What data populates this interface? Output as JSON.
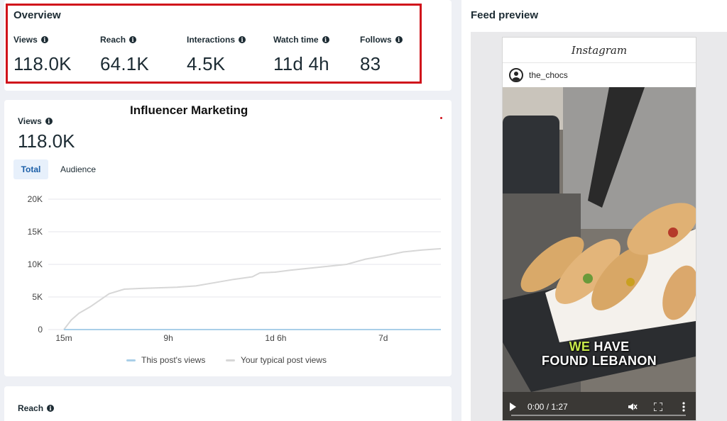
{
  "overview": {
    "title": "Overview",
    "metrics": [
      {
        "label": "Views",
        "value": "118.0K"
      },
      {
        "label": "Reach",
        "value": "64.1K"
      },
      {
        "label": "Interactions",
        "value": "4.5K"
      },
      {
        "label": "Watch time",
        "value": "11d 4h"
      },
      {
        "label": "Follows",
        "value": "83"
      }
    ]
  },
  "views_chart": {
    "title": "Influencer Marketing",
    "metric_label": "Views",
    "metric_value": "118.0K",
    "tabs": [
      "Total",
      "Audience"
    ],
    "active_tab": "Total",
    "legend": [
      {
        "label": "This post's views",
        "color": "#a9cfe8"
      },
      {
        "label": "Your typical post views",
        "color": "#d7d7d7"
      }
    ]
  },
  "chart_data": {
    "type": "line",
    "title": "",
    "xlabel": "",
    "ylabel": "",
    "x_tick_labels": [
      "15m",
      "9h",
      "1d 6h",
      "7d"
    ],
    "y_tick_labels": [
      "0",
      "5K",
      "10K",
      "15K",
      "20K"
    ],
    "ylim": [
      0,
      20000
    ],
    "grid": true,
    "legend_position": "bottom",
    "series": [
      {
        "name": "Your typical post views",
        "color": "#d7d7d7",
        "x": [
          0,
          0.02,
          0.04,
          0.07,
          0.12,
          0.16,
          0.2,
          0.25,
          0.3,
          0.35,
          0.4,
          0.45,
          0.5,
          0.52,
          0.56,
          0.6,
          0.65,
          0.7,
          0.75,
          0.8,
          0.85,
          0.9,
          0.95,
          1
        ],
        "y": [
          0,
          1500,
          2500,
          3500,
          5500,
          6200,
          6300,
          6400,
          6500,
          6700,
          7200,
          7700,
          8100,
          8700,
          8800,
          9100,
          9400,
          9700,
          10000,
          10800,
          11300,
          11900,
          12200,
          12400
        ]
      },
      {
        "name": "This post's views",
        "color": "#a9cfe8",
        "x": [
          0,
          1
        ],
        "y": [
          0,
          0
        ]
      }
    ]
  },
  "reach_section": {
    "label": "Reach"
  },
  "feed_preview": {
    "title": "Feed preview",
    "app_name": "Instagram",
    "username": "the_chocs",
    "caption_line1_highlight": "WE",
    "caption_line1_rest": " HAVE",
    "caption_line2": "FOUND LEBANON",
    "video_time": "0:00 / 1:27",
    "video_progress": 0
  },
  "icons": {
    "info": "info-icon",
    "play": "play-icon",
    "mute": "mute-icon",
    "fullscreen": "fullscreen-icon",
    "more": "more-vertical-icon"
  }
}
